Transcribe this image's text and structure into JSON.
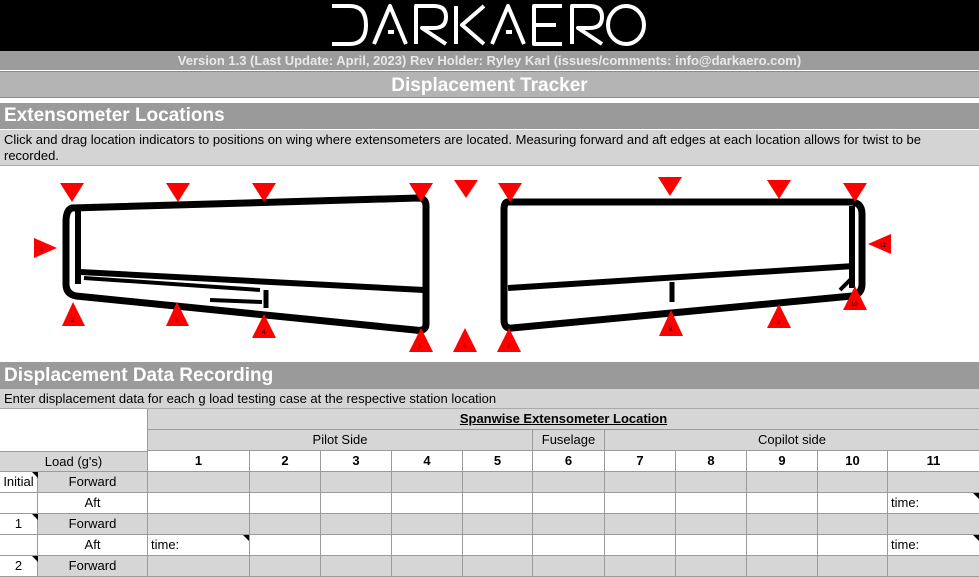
{
  "header": {
    "logo_text": "DARKAERO",
    "version_line": "Version 1.3 (Last Update: April, 2023) Rev Holder: Ryley Karl (issues/comments: info@darkaero.com)",
    "page_title": "Displacement Tracker"
  },
  "extensometer": {
    "title": "Extensometer Locations",
    "description": "Click and drag location indicators to positions on wing where extensometers are located. Measuring forward and aft edges at each location allows for twist to be recorded.",
    "marker_color": "#ff0000",
    "markers": [
      {
        "id": "1",
        "dir": "right"
      },
      {
        "id": "2",
        "dir": "up"
      },
      {
        "id": "3",
        "dir": "up"
      },
      {
        "id": "4",
        "dir": "up"
      },
      {
        "id": "5",
        "dir": "up"
      },
      {
        "id": "6",
        "dir": "up"
      },
      {
        "id": "7",
        "dir": "up"
      },
      {
        "id": "8",
        "dir": "up"
      },
      {
        "id": "9",
        "dir": "up"
      },
      {
        "id": "10",
        "dir": "up"
      },
      {
        "id": "11",
        "dir": "left"
      }
    ]
  },
  "recording": {
    "title": "Displacement Data Recording",
    "description": "Enter displacement data for each g load testing case at the respective station location",
    "table": {
      "spanwise_header": "Spanwise Extensometer Location",
      "groups": [
        "Pilot Side",
        "Fuselage",
        "Copilot side"
      ],
      "load_header": "Load (g's)",
      "stations": [
        "1",
        "2",
        "3",
        "4",
        "5",
        "6",
        "7",
        "8",
        "9",
        "10",
        "11"
      ],
      "rows": [
        {
          "load": "Initial",
          "edge": "Forward",
          "cells": [
            "",
            "",
            "",
            "",
            "",
            "",
            "",
            "",
            "",
            "",
            ""
          ]
        },
        {
          "load": "",
          "edge": "Aft",
          "cells": [
            "",
            "",
            "",
            "",
            "",
            "",
            "",
            "",
            "",
            "",
            "time:"
          ]
        },
        {
          "load": "1",
          "edge": "Forward",
          "cells": [
            "",
            "",
            "",
            "",
            "",
            "",
            "",
            "",
            "",
            "",
            ""
          ]
        },
        {
          "load": "",
          "edge": "Aft",
          "cells": [
            "time:",
            "",
            "",
            "",
            "",
            "",
            "",
            "",
            "",
            "",
            "time:"
          ]
        },
        {
          "load": "2",
          "edge": "Forward",
          "cells": [
            "",
            "",
            "",
            "",
            "",
            "",
            "",
            "",
            "",
            "",
            ""
          ]
        }
      ]
    }
  }
}
